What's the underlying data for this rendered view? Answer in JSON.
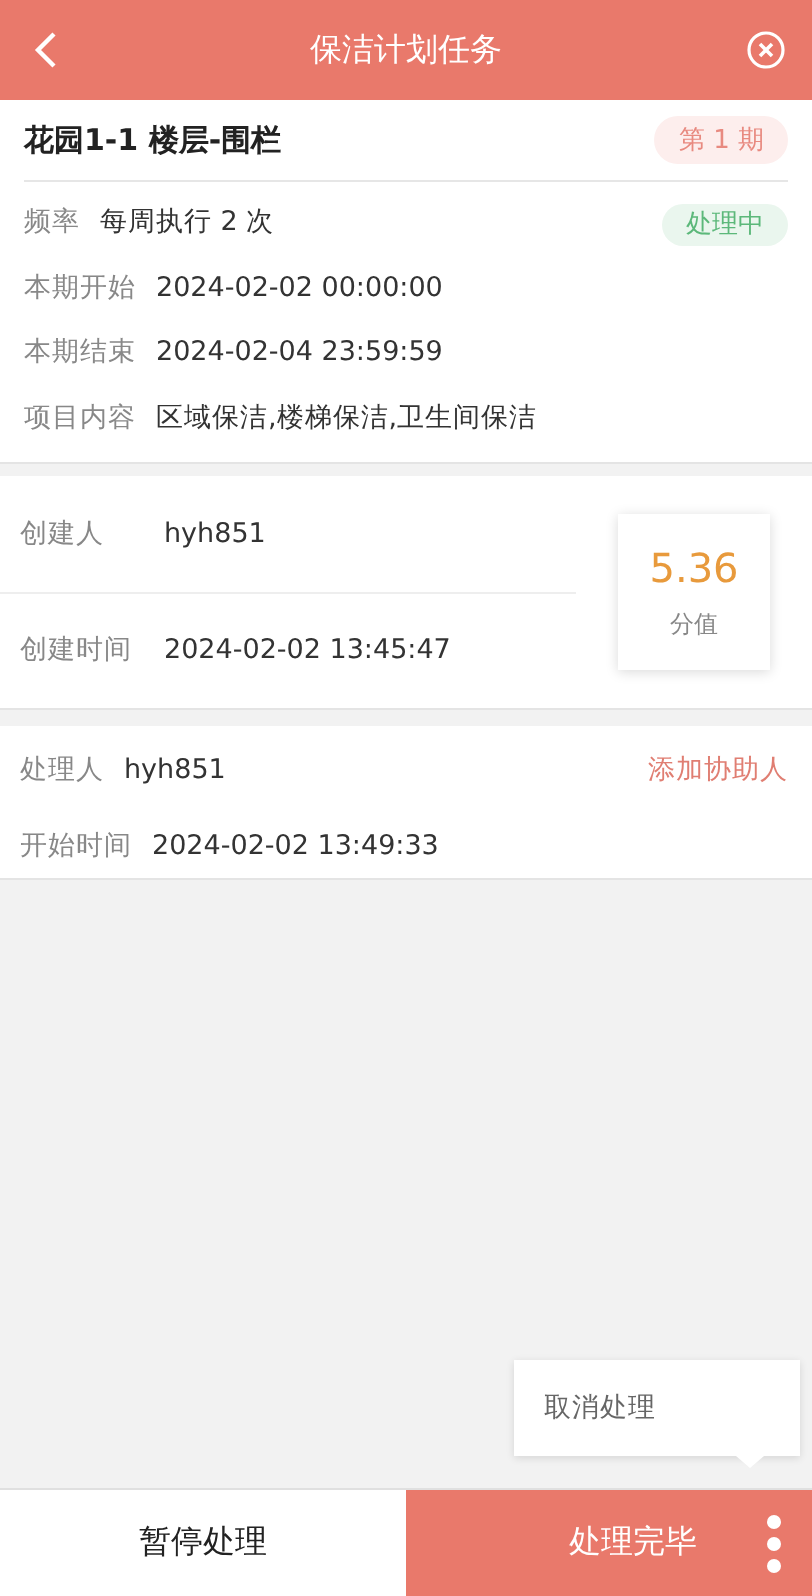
{
  "header": {
    "title": "保洁计划任务"
  },
  "task": {
    "name": "花园1-1 楼层-围栏",
    "period_badge": "第 1 期",
    "status_badge": "处理中",
    "fields": [
      {
        "label": "频率",
        "value": "每周执行 2 次"
      },
      {
        "label": "本期开始",
        "value": "2024-02-02 00:00:00"
      },
      {
        "label": "本期结束",
        "value": "2024-02-04 23:59:59"
      },
      {
        "label": "项目内容",
        "value": "区域保洁,楼梯保洁,卫生间保洁"
      }
    ]
  },
  "creator": {
    "fields": [
      {
        "label": "创建人",
        "value": "hyh851"
      },
      {
        "label": "创建时间",
        "value": "2024-02-02 13:45:47"
      }
    ],
    "score": "5.36",
    "score_label": "分值"
  },
  "handler": {
    "fields": [
      {
        "label": "处理人",
        "value": "hyh851"
      },
      {
        "label": "开始时间",
        "value": "2024-02-02 13:49:33"
      }
    ],
    "action": "添加协助人"
  },
  "popup_menu": [
    "取消处理"
  ],
  "footer": {
    "secondary": "暂停处理",
    "primary": "处理完毕"
  }
}
